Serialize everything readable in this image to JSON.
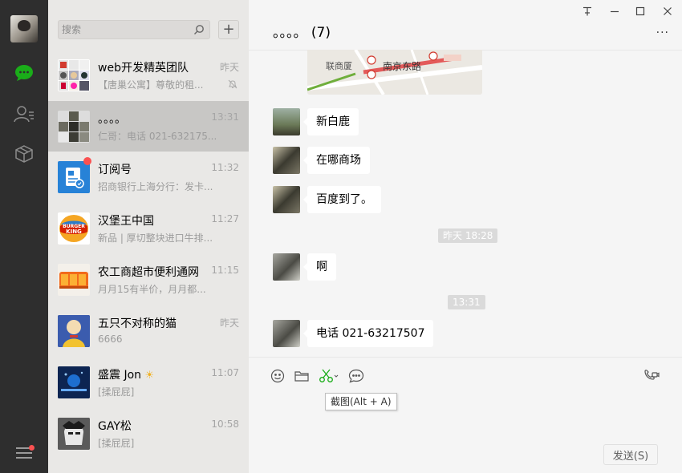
{
  "sidebar": {
    "avatar_icon": "user-avatar",
    "nav_icons": [
      "chat-bubble-icon",
      "contacts-icon",
      "favorites-box-icon"
    ],
    "menu_icon": "menu-icon",
    "active_color": "#1aad19"
  },
  "search": {
    "placeholder": "搜索",
    "add_label": "+"
  },
  "sessions": [
    {
      "name": "web开发精英团队",
      "time": "昨天",
      "preview": "【唐巢公寓】尊敬的租...",
      "muted": true
    },
    {
      "name": "。。。。",
      "time": "13:31",
      "preview": "仁哥：电话 021-632175..."
    },
    {
      "name": "订阅号",
      "time": "11:32",
      "preview": "招商银行上海分行：发卡...",
      "unread": true
    },
    {
      "name": "汉堡王中国",
      "time": "11:27",
      "preview": "新品 | 厚切整块进口牛排..."
    },
    {
      "name": "农工商超市便利通网",
      "time": "11:15",
      "preview": "月月15有半价，月月都..."
    },
    {
      "name": "五只不对称的猫",
      "time": "昨天",
      "preview": "6666"
    },
    {
      "name": "盛震 Jon",
      "time": "11:07",
      "preview": "[揉屁屁]"
    },
    {
      "name": "GAY松",
      "time": "10:58",
      "preview": "[揉屁屁]"
    }
  ],
  "chat": {
    "title": "。。。。 (7)",
    "more_label": "...",
    "window_controls": [
      "pin-icon",
      "minimize-icon",
      "maximize-icon",
      "close-icon"
    ],
    "map": {
      "poi1": "联商厦",
      "poi2": "南京东路"
    },
    "messages": [
      {
        "text": "新白鹿"
      },
      {
        "text": "在哪商场"
      },
      {
        "text": "百度到了。"
      },
      {
        "time": "昨天 18:28"
      },
      {
        "text": "啊"
      },
      {
        "time": "13:31"
      },
      {
        "text": "电话  021-63217507"
      }
    ],
    "toolbar": {
      "tools": [
        "emoji-icon",
        "folder-icon",
        "scissors-icon",
        "chat-history-icon"
      ],
      "call_icon": "video-call-icon",
      "tooltip": "截图(Alt + A)"
    },
    "send_label": "发送(S)"
  }
}
